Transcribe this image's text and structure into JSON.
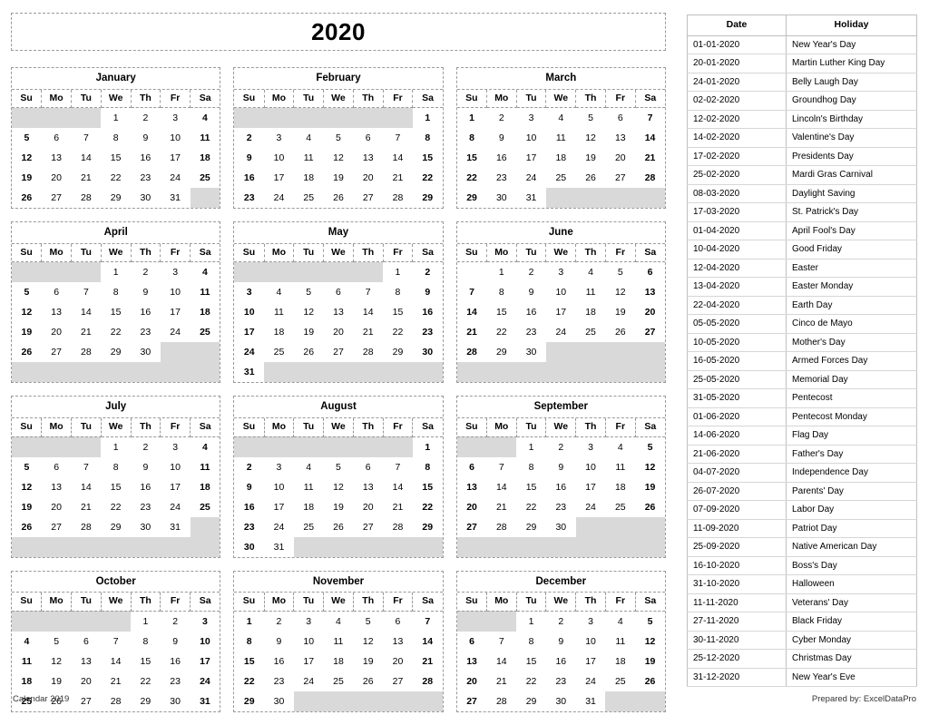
{
  "title": "2020",
  "weekday_headers": [
    "Su",
    "Mo",
    "Tu",
    "We",
    "Th",
    "Fr",
    "Sa"
  ],
  "footer": {
    "left": "Calendar 2019",
    "right": "Prepared by: ExcelDataPro"
  },
  "holiday_table": {
    "columns": [
      "Date",
      "Holiday"
    ],
    "rows": [
      {
        "date": "01-01-2020",
        "holiday": "New Year's Day"
      },
      {
        "date": "20-01-2020",
        "holiday": "Martin Luther King Day"
      },
      {
        "date": "24-01-2020",
        "holiday": "Belly Laugh Day"
      },
      {
        "date": "02-02-2020",
        "holiday": "Groundhog Day"
      },
      {
        "date": "12-02-2020",
        "holiday": "Lincoln's Birthday"
      },
      {
        "date": "14-02-2020",
        "holiday": "Valentine's Day"
      },
      {
        "date": "17-02-2020",
        "holiday": "Presidents Day"
      },
      {
        "date": "25-02-2020",
        "holiday": "Mardi Gras Carnival"
      },
      {
        "date": "08-03-2020",
        "holiday": "Daylight Saving"
      },
      {
        "date": "17-03-2020",
        "holiday": "St. Patrick's Day"
      },
      {
        "date": "01-04-2020",
        "holiday": "April Fool's Day"
      },
      {
        "date": "10-04-2020",
        "holiday": "Good Friday"
      },
      {
        "date": "12-04-2020",
        "holiday": "Easter"
      },
      {
        "date": "13-04-2020",
        "holiday": "Easter Monday"
      },
      {
        "date": "22-04-2020",
        "holiday": "Earth Day"
      },
      {
        "date": "05-05-2020",
        "holiday": "Cinco de Mayo"
      },
      {
        "date": "10-05-2020",
        "holiday": "Mother's Day"
      },
      {
        "date": "16-05-2020",
        "holiday": "Armed Forces Day"
      },
      {
        "date": "25-05-2020",
        "holiday": "Memorial Day"
      },
      {
        "date": "31-05-2020",
        "holiday": "Pentecost"
      },
      {
        "date": "01-06-2020",
        "holiday": "Pentecost Monday"
      },
      {
        "date": "14-06-2020",
        "holiday": "Flag Day"
      },
      {
        "date": "21-06-2020",
        "holiday": "Father's Day"
      },
      {
        "date": "04-07-2020",
        "holiday": "Independence Day"
      },
      {
        "date": "26-07-2020",
        "holiday": "Parents' Day"
      },
      {
        "date": "07-09-2020",
        "holiday": "Labor Day"
      },
      {
        "date": "11-09-2020",
        "holiday": "Patriot Day"
      },
      {
        "date": "25-09-2020",
        "holiday": "Native American Day"
      },
      {
        "date": "16-10-2020",
        "holiday": "Boss's Day"
      },
      {
        "date": "31-10-2020",
        "holiday": "Halloween"
      },
      {
        "date": "11-11-2020",
        "holiday": "Veterans' Day"
      },
      {
        "date": "27-11-2020",
        "holiday": "Black Friday"
      },
      {
        "date": "30-11-2020",
        "holiday": "Cyber Monday"
      },
      {
        "date": "25-12-2020",
        "holiday": "Christmas Day"
      },
      {
        "date": "31-12-2020",
        "holiday": "New Year's Eve"
      }
    ]
  },
  "months": [
    {
      "name": "January",
      "weeks": [
        [
          "",
          "",
          "",
          "1",
          "2",
          "3",
          "4"
        ],
        [
          "5",
          "6",
          "7",
          "8",
          "9",
          "10",
          "11"
        ],
        [
          "12",
          "13",
          "14",
          "15",
          "16",
          "17",
          "18"
        ],
        [
          "19",
          "20",
          "21",
          "22",
          "23",
          "24",
          "25"
        ],
        [
          "26",
          "27",
          "28",
          "29",
          "30",
          "31",
          ""
        ]
      ]
    },
    {
      "name": "February",
      "weeks": [
        [
          "",
          "",
          "",
          "",
          "",
          "",
          "1"
        ],
        [
          "2",
          "3",
          "4",
          "5",
          "6",
          "7",
          "8"
        ],
        [
          "9",
          "10",
          "11",
          "12",
          "13",
          "14",
          "15"
        ],
        [
          "16",
          "17",
          "18",
          "19",
          "20",
          "21",
          "22"
        ],
        [
          "23",
          "24",
          "25",
          "26",
          "27",
          "28",
          "29"
        ]
      ]
    },
    {
      "name": "March",
      "weeks": [
        [
          "1",
          "2",
          "3",
          "4",
          "5",
          "6",
          "7"
        ],
        [
          "8",
          "9",
          "10",
          "11",
          "12",
          "13",
          "14"
        ],
        [
          "15",
          "16",
          "17",
          "18",
          "19",
          "20",
          "21"
        ],
        [
          "22",
          "23",
          "24",
          "25",
          "26",
          "27",
          "28"
        ],
        [
          "29",
          "30",
          "31",
          "",
          "",
          "",
          ""
        ]
      ]
    },
    {
      "name": "April",
      "weeks": [
        [
          "",
          "",
          "",
          "1",
          "2",
          "3",
          "4"
        ],
        [
          "5",
          "6",
          "7",
          "8",
          "9",
          "10",
          "11"
        ],
        [
          "12",
          "13",
          "14",
          "15",
          "16",
          "17",
          "18"
        ],
        [
          "19",
          "20",
          "21",
          "22",
          "23",
          "24",
          "25"
        ],
        [
          "26",
          "27",
          "28",
          "29",
          "30",
          "",
          ""
        ],
        [
          "",
          "",
          "",
          "",
          "",
          "",
          ""
        ]
      ]
    },
    {
      "name": "May",
      "weeks": [
        [
          "",
          "",
          "",
          "",
          "",
          "1",
          "2"
        ],
        [
          "3",
          "4",
          "5",
          "6",
          "7",
          "8",
          "9"
        ],
        [
          "10",
          "11",
          "12",
          "13",
          "14",
          "15",
          "16"
        ],
        [
          "17",
          "18",
          "19",
          "20",
          "21",
          "22",
          "23"
        ],
        [
          "24",
          "25",
          "26",
          "27",
          "28",
          "29",
          "30"
        ],
        [
          "31",
          "",
          "",
          "",
          "",
          "",
          ""
        ]
      ]
    },
    {
      "name": "June",
      "weeks": [
        [
          "",
          "1",
          "2",
          "3",
          "4",
          "5",
          "6"
        ],
        [
          "7",
          "8",
          "9",
          "10",
          "11",
          "12",
          "13"
        ],
        [
          "14",
          "15",
          "16",
          "17",
          "18",
          "19",
          "20"
        ],
        [
          "21",
          "22",
          "23",
          "24",
          "25",
          "26",
          "27"
        ],
        [
          "28",
          "29",
          "30",
          "",
          "",
          "",
          ""
        ],
        [
          "",
          "",
          "",
          "",
          "",
          "",
          ""
        ]
      ]
    },
    {
      "name": "July",
      "weeks": [
        [
          "",
          "",
          "",
          "1",
          "2",
          "3",
          "4"
        ],
        [
          "5",
          "6",
          "7",
          "8",
          "9",
          "10",
          "11"
        ],
        [
          "12",
          "13",
          "14",
          "15",
          "16",
          "17",
          "18"
        ],
        [
          "19",
          "20",
          "21",
          "22",
          "23",
          "24",
          "25"
        ],
        [
          "26",
          "27",
          "28",
          "29",
          "30",
          "31",
          ""
        ],
        [
          "",
          "",
          "",
          "",
          "",
          "",
          ""
        ]
      ]
    },
    {
      "name": "August",
      "weeks": [
        [
          "",
          "",
          "",
          "",
          "",
          "",
          "1"
        ],
        [
          "2",
          "3",
          "4",
          "5",
          "6",
          "7",
          "8"
        ],
        [
          "9",
          "10",
          "11",
          "12",
          "13",
          "14",
          "15"
        ],
        [
          "16",
          "17",
          "18",
          "19",
          "20",
          "21",
          "22"
        ],
        [
          "23",
          "24",
          "25",
          "26",
          "27",
          "28",
          "29"
        ],
        [
          "30",
          "31",
          "",
          "",
          "",
          "",
          ""
        ]
      ]
    },
    {
      "name": "September",
      "weeks": [
        [
          "",
          "",
          "1",
          "2",
          "3",
          "4",
          "5"
        ],
        [
          "6",
          "7",
          "8",
          "9",
          "10",
          "11",
          "12"
        ],
        [
          "13",
          "14",
          "15",
          "16",
          "17",
          "18",
          "19"
        ],
        [
          "20",
          "21",
          "22",
          "23",
          "24",
          "25",
          "26"
        ],
        [
          "27",
          "28",
          "29",
          "30",
          "",
          "",
          ""
        ],
        [
          "",
          "",
          "",
          "",
          "",
          "",
          ""
        ]
      ]
    },
    {
      "name": "October",
      "weeks": [
        [
          "",
          "",
          "",
          "",
          "1",
          "2",
          "3"
        ],
        [
          "4",
          "5",
          "6",
          "7",
          "8",
          "9",
          "10"
        ],
        [
          "11",
          "12",
          "13",
          "14",
          "15",
          "16",
          "17"
        ],
        [
          "18",
          "19",
          "20",
          "21",
          "22",
          "23",
          "24"
        ],
        [
          "25",
          "26",
          "27",
          "28",
          "29",
          "30",
          "31"
        ]
      ]
    },
    {
      "name": "November",
      "weeks": [
        [
          "1",
          "2",
          "3",
          "4",
          "5",
          "6",
          "7"
        ],
        [
          "8",
          "9",
          "10",
          "11",
          "12",
          "13",
          "14"
        ],
        [
          "15",
          "16",
          "17",
          "18",
          "19",
          "20",
          "21"
        ],
        [
          "22",
          "23",
          "24",
          "25",
          "26",
          "27",
          "28"
        ],
        [
          "29",
          "30",
          "",
          "",
          "",
          "",
          ""
        ]
      ]
    },
    {
      "name": "December",
      "weeks": [
        [
          "",
          "",
          "1",
          "2",
          "3",
          "4",
          "5"
        ],
        [
          "6",
          "7",
          "8",
          "9",
          "10",
          "11",
          "12"
        ],
        [
          "13",
          "14",
          "15",
          "16",
          "17",
          "18",
          "19"
        ],
        [
          "20",
          "21",
          "22",
          "23",
          "24",
          "25",
          "26"
        ],
        [
          "27",
          "28",
          "29",
          "30",
          "31",
          "",
          ""
        ]
      ]
    }
  ],
  "colors": {
    "blank_cell": "#d9d9d9",
    "border_dashed": "#9a9a9a",
    "table_border": "#bfbfbf",
    "text": "#000000"
  }
}
